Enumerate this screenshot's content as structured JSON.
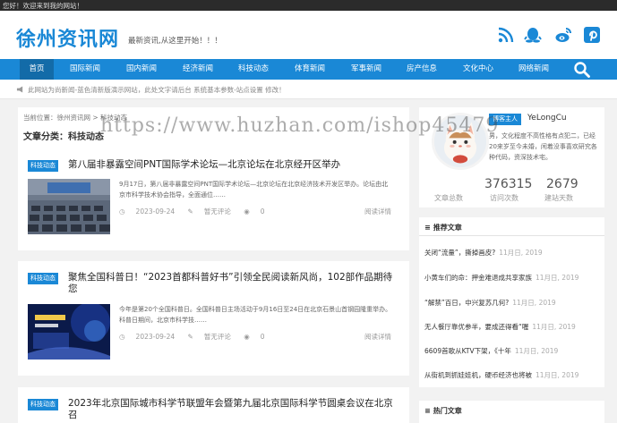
{
  "colors": {
    "accent": "#1a88d6",
    "nav_active": "#136ba8",
    "topbar": "#2b2b2b"
  },
  "topbar": {
    "welcome": "您好！欢迎来到我的网站！"
  },
  "header": {
    "logo": "徐州资讯网",
    "slogan": "最新资讯,从这里开始！！！",
    "social_icons": [
      "rss-icon",
      "qq-icon",
      "weibo-icon",
      "pinterest-icon"
    ]
  },
  "nav": {
    "items": [
      "首页",
      "国际新闻",
      "国内新闻",
      "经济新闻",
      "科技动态",
      "体育新闻",
      "军事新闻",
      "房产信息",
      "文化中心",
      "网络新闻"
    ],
    "active_index": 0
  },
  "notice": {
    "text": "此网站为尚新闻-蓝色清新版演示网站，此处文字请后台 系统基本参数-站点设置 修改！"
  },
  "breadcrumb": {
    "text": "当前位置：徐州资讯网 > 科技动态"
  },
  "category": {
    "title": "文章分类：科技动态"
  },
  "articles": [
    {
      "tag": "科技动态",
      "title": "第八届非暴露空间PNT国际学术论坛—北京论坛在北京经开区举办",
      "excerpt": "9月17日，第八届非暴露空间PNT国际学术论坛—北京论坛在北京经济技术开发区举办。论坛由北京市科学技术协会指导，全面通位……",
      "date": "2023-09-24",
      "comments": "暂无评论",
      "views": "0",
      "more": "阅读详情"
    },
    {
      "tag": "科技动态",
      "title": "聚焦全国科普日！“2023首都科普好书”引领全民阅读新风尚，102部作品期待您",
      "excerpt": "今年是第20个全国科普日。全国科普日主场活动于9月16日至24日在北京石景山首钢园隆重举办。科普日期间，北京市科学技……",
      "date": "2023-09-24",
      "comments": "暂无评论",
      "views": "0",
      "more": "阅读详情"
    },
    {
      "tag": "科技动态",
      "title": "2023年北京国际城市科学节联盟年会暨第九届北京国际科学节圆桌会议在北京召"
    }
  ],
  "profile": {
    "badge": "博客主人",
    "name": "YeLongCu",
    "bio": "男，文化程度不高性格有点犯二，已经20来岁至今未婚，闲着没事喜欢研究各种代码，资深技术宅。",
    "stats": [
      {
        "value": "376315",
        "label": "访问次数"
      },
      {
        "value": "2679",
        "label": "建站天数"
      }
    ],
    "articles_label": "文章总数"
  },
  "recommended": {
    "title": "推荐文章",
    "items": [
      {
        "text": "关闭“流量”，撕掉画皮?",
        "date": "11月日, 2019"
      },
      {
        "text": "小黄车们的命：押金难退成共享家族",
        "date": "11月日, 2019"
      },
      {
        "text": "“解禁”百日，中兴复苏几何?",
        "date": "11月日, 2019"
      },
      {
        "text": "无人餐厅靠优参半，要成还得看“喔",
        "date": "11月日, 2019"
      },
      {
        "text": "6609首歌从KTV下架，《十年",
        "date": "11月日, 2019"
      },
      {
        "text": "从街机到抓娃娃机，硬币经济也将被",
        "date": "11月日, 2019"
      }
    ]
  },
  "hot": {
    "title": "热门文章"
  },
  "watermark": "https://www.huzhan.com/ishop45479"
}
